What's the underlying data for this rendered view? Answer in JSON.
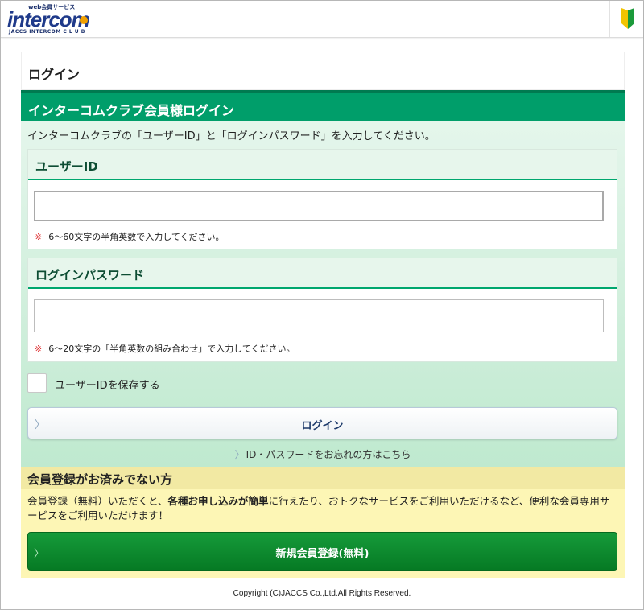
{
  "header": {
    "logo": {
      "tagline": "web会員サービス",
      "wordmark": "intercom",
      "subline": "JACCS INTERCOM C L U B"
    },
    "beginner_icon": "wakaba-beginner-mark-icon",
    "brand_colors": {
      "navy": "#1f3a8a",
      "gold": "#f0a000"
    }
  },
  "page": {
    "title": "ログイン"
  },
  "login": {
    "header": "インターコムクラブ会員様ログイン",
    "intro": "インターコムクラブの「ユーザーID」と「ログインパスワード」を入力してください。",
    "user_id": {
      "label": "ユーザーID",
      "value": "",
      "placeholder": "",
      "note_mark": "※",
      "note": "6〜60文字の半角英数で入力してください。"
    },
    "password": {
      "label": "ログインパスワード",
      "value": "",
      "placeholder": "",
      "note_mark": "※",
      "note": "6〜20文字の「半角英数の組み合わせ」で入力してください。"
    },
    "save_user_id": {
      "label": "ユーザーIDを保存する",
      "checked": false
    },
    "login_button": "ログイン",
    "chevron": "〉",
    "forgot_link": "ID・パスワードをお忘れの方はこちら",
    "accent_color": "#009e6a"
  },
  "register": {
    "header": "会員登録がお済みでない方",
    "description_parts": [
      "会員登録（無料）いただくと、",
      "各種お申し込みが簡単",
      "に行えたり、おトクなサービスをご利用いただけるなど、便利な会員専用サービスをご利用いただけます！"
    ],
    "button": "新規会員登録(無料)",
    "button_color": "#0e8a2e"
  },
  "footer": {
    "copyright": "Copyright (C)JACCS Co.,Ltd.All Rights Reserved."
  }
}
